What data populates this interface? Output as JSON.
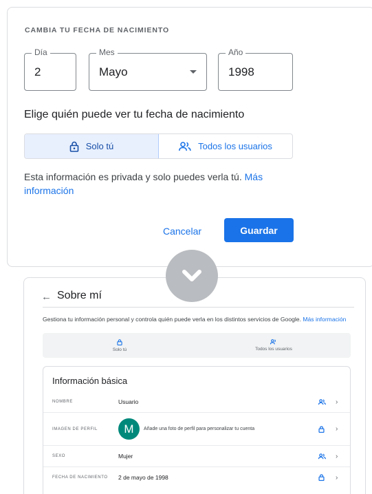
{
  "dialog": {
    "title": "CAMBIA TU FECHA DE NACIMIENTO",
    "day": {
      "label": "Día",
      "value": "2"
    },
    "month": {
      "label": "Mes",
      "value": "Mayo"
    },
    "year": {
      "label": "Año",
      "value": "1998"
    },
    "subtitle": "Elige quién puede ver tu fecha de nacimiento",
    "visibility": {
      "only_you": "Solo tú",
      "all_users": "Todos los usuarios",
      "selected": "only_you"
    },
    "info_text": "Esta información es privada y solo puedes verla tú.",
    "info_link": "Más información",
    "cancel_label": "Cancelar",
    "save_label": "Guardar"
  },
  "page": {
    "back_icon": "arrow-back-icon",
    "title": "Sobre mí",
    "description": "Gestiona tu información personal y controla quién puede verla en los distintos servicios de Google.",
    "description_link": "Más información",
    "visibility_bar": {
      "only_you": "Solo tú",
      "all_users": "Todos los usuarios"
    },
    "basic_info": {
      "title": "Información básica",
      "rows": [
        {
          "label": "NOMBRE",
          "value": "Usuario",
          "visibility_icon": "people-icon"
        },
        {
          "label": "IMAGEN DE PERFIL",
          "avatar_letter": "M",
          "value": "Añade una foto de perfil para personalizar tu cuenta",
          "visibility_icon": "lock-icon"
        },
        {
          "label": "SEXO",
          "value": "Mujer",
          "visibility_icon": "people-icon"
        },
        {
          "label": "FECHA DE NACIMIENTO",
          "value": "2 de mayo de 1998",
          "visibility_icon": "lock-icon"
        }
      ]
    }
  },
  "colors": {
    "accent": "#1a73e8",
    "selected_bg": "#e8f0fe",
    "avatar": "#00897b",
    "overlay_circle": "#b9bcc0"
  }
}
